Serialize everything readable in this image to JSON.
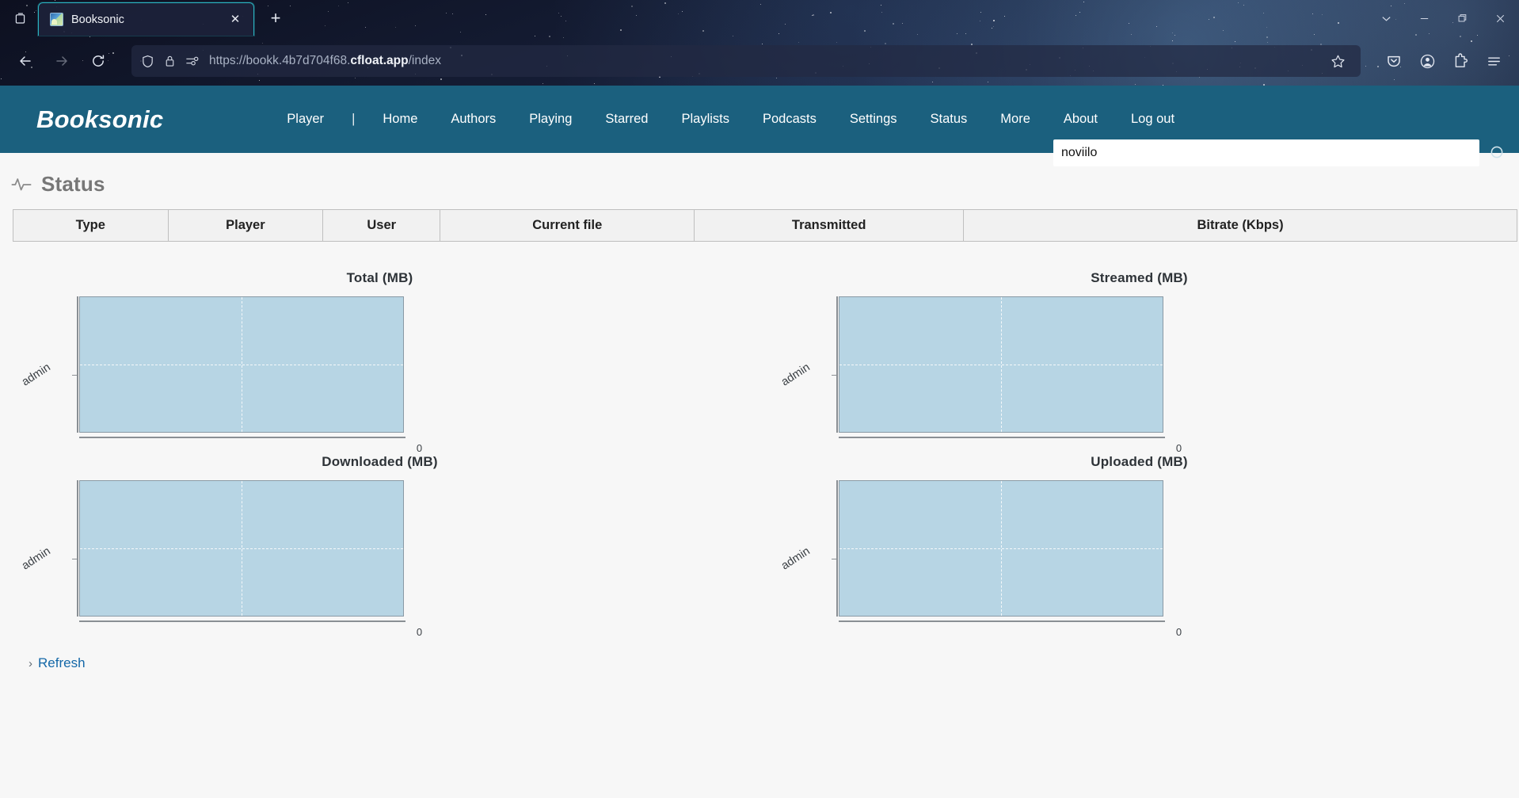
{
  "browser": {
    "tab": {
      "title": "Booksonic",
      "favicon": "image-favicon",
      "close_label": "✕"
    },
    "newtab_label": "+",
    "tab_list_icon": "tab-list-icon",
    "window_controls": {
      "tab_overview": "chevron-down-icon",
      "minimize": "—",
      "maximize": "maximize-icon",
      "close": "✕"
    },
    "toolbar": {
      "back": "back-arrow-icon",
      "forward": "forward-arrow-icon",
      "reload": "reload-icon",
      "shield": "shield-icon",
      "lock": "lock-icon",
      "permissions": "permissions-icon",
      "bookmark": "star-icon",
      "pocket": "pocket-icon",
      "account": "account-icon",
      "extensions": "extensions-icon",
      "app_menu": "hamburger-menu-icon"
    },
    "url": {
      "prefix": "https://bookk.4b7d704f68.",
      "domain": "cfloat.app",
      "suffix": "/index",
      "full": "https://bookk.4b7d704f68.cfloat.app/index"
    }
  },
  "app": {
    "brand": "Booksonic",
    "nav": [
      {
        "label": "Player"
      },
      {
        "label": "|",
        "separator": true
      },
      {
        "label": "Home"
      },
      {
        "label": "Authors"
      },
      {
        "label": "Playing"
      },
      {
        "label": "Starred"
      },
      {
        "label": "Playlists"
      },
      {
        "label": "Podcasts"
      },
      {
        "label": "Settings"
      },
      {
        "label": "Status"
      },
      {
        "label": "More"
      },
      {
        "label": "About"
      },
      {
        "label": "Log out"
      }
    ],
    "search": {
      "value": "noviilo",
      "placeholder": "",
      "icon": "search-icon"
    }
  },
  "page": {
    "title": "Status",
    "title_icon": "pulse-icon",
    "table": {
      "headers": [
        "Type",
        "Player",
        "User",
        "Current file",
        "Transmitted",
        "Bitrate (Kbps)"
      ],
      "rows": []
    },
    "refresh": {
      "label": "Refresh",
      "chevron": "›"
    }
  },
  "chart_data": [
    {
      "type": "bar",
      "orientation": "horizontal",
      "title": "Total (MB)",
      "categories": [
        "admin"
      ],
      "values": [
        0
      ],
      "xlabel": "",
      "ylabel": "",
      "xticks": [
        "0"
      ],
      "xlim": [
        0,
        0
      ],
      "grid": true,
      "legend": false,
      "plot_color": "#b7d5e4"
    },
    {
      "type": "bar",
      "orientation": "horizontal",
      "title": "Streamed (MB)",
      "categories": [
        "admin"
      ],
      "values": [
        0
      ],
      "xlabel": "",
      "ylabel": "",
      "xticks": [
        "0"
      ],
      "xlim": [
        0,
        0
      ],
      "grid": true,
      "legend": false,
      "plot_color": "#b7d5e4"
    },
    {
      "type": "bar",
      "orientation": "horizontal",
      "title": "Downloaded (MB)",
      "categories": [
        "admin"
      ],
      "values": [
        0
      ],
      "xlabel": "",
      "ylabel": "",
      "xticks": [
        "0"
      ],
      "xlim": [
        0,
        0
      ],
      "grid": true,
      "legend": false,
      "plot_color": "#b7d5e4"
    },
    {
      "type": "bar",
      "orientation": "horizontal",
      "title": "Uploaded (MB)",
      "categories": [
        "admin"
      ],
      "values": [
        0
      ],
      "xlabel": "",
      "ylabel": "",
      "xticks": [
        "0"
      ],
      "xlim": [
        0,
        0
      ],
      "grid": true,
      "legend": false,
      "plot_color": "#b7d5e4"
    }
  ],
  "colors": {
    "app_nav": "#1b607e",
    "link": "#1468a8",
    "plot_fill": "#b7d5e4",
    "page_bg": "#f7f7f7"
  }
}
